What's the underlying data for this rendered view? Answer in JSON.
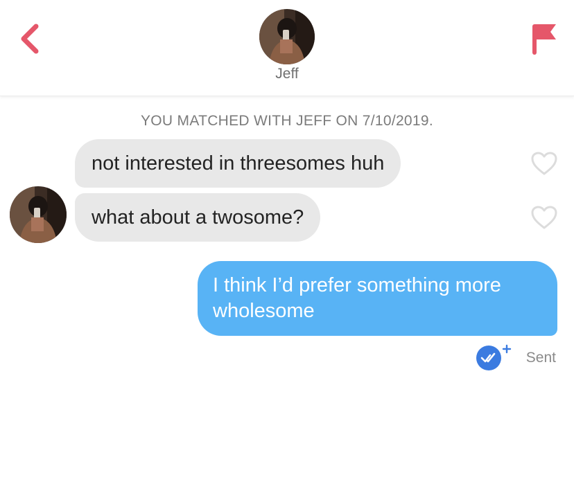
{
  "header": {
    "name": "Jeff",
    "back_icon": "chevron-left-icon",
    "report_icon": "flag-icon",
    "accent_color": "#e5576a"
  },
  "conversation": {
    "match_notice": "YOU MATCHED WITH JEFF ON 7/10/2019.",
    "messages": [
      {
        "from": "Jeff",
        "text": "not interested in threesomes huh",
        "like_icon": "heart-outline-icon"
      },
      {
        "from": "Jeff",
        "text": "what about a twosome?",
        "like_icon": "heart-outline-icon"
      },
      {
        "from": "me",
        "text": "I think I’d prefer something more wholesome"
      }
    ],
    "receipt_icon": "read-receipt-icon",
    "status": "Sent",
    "incoming_color": "#e8e8e8",
    "outgoing_color": "#58b3f5"
  }
}
